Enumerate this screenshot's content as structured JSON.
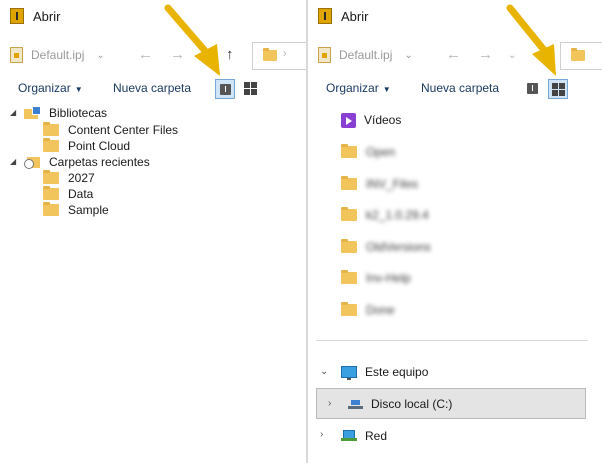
{
  "left": {
    "title": "Abrir",
    "file_name": "Default.ipj",
    "toolbar": {
      "organize": "Organizar",
      "new_folder": "Nueva carpeta"
    },
    "active_view": "details",
    "tree": [
      {
        "label": "Bibliotecas",
        "level": 0,
        "icon": "library-icon"
      },
      {
        "label": "Content Center Files",
        "level": 1,
        "icon": "folder-icon"
      },
      {
        "label": "Point Cloud",
        "level": 1,
        "icon": "folder-icon"
      },
      {
        "label": "Carpetas recientes",
        "level": 0,
        "icon": "recent-folders-icon"
      },
      {
        "label": "2027",
        "level": 1,
        "icon": "folder-icon"
      },
      {
        "label": "Data",
        "level": 1,
        "icon": "folder-icon"
      },
      {
        "label": "Sample",
        "level": 1,
        "icon": "folder-icon"
      }
    ]
  },
  "right": {
    "title": "Abrir",
    "file_name": "Default.ipj",
    "toolbar": {
      "organize": "Organizar",
      "new_folder": "Nueva carpeta"
    },
    "active_view": "tiles",
    "quick_items": [
      {
        "label": "Vídeos",
        "icon": "videos-icon",
        "blurred": false
      },
      {
        "label": "Open",
        "icon": "folder-icon",
        "blurred": true
      },
      {
        "label": "INV_Files",
        "icon": "folder-icon",
        "blurred": true
      },
      {
        "label": "k2_1.0.29.4",
        "icon": "folder-icon",
        "blurred": true
      },
      {
        "label": "OldVersions",
        "icon": "folder-icon",
        "blurred": true
      },
      {
        "label": "Inv-Help",
        "icon": "folder-icon",
        "blurred": true
      },
      {
        "label": "Done",
        "icon": "folder-icon",
        "blurred": true
      }
    ],
    "this_pc": "Este equipo",
    "local_disk": "Disco local (C:)",
    "network": "Red"
  },
  "colors": {
    "arrow": "#e8b400",
    "selection": "#e4e4e4",
    "link_text": "#1a3a63"
  }
}
